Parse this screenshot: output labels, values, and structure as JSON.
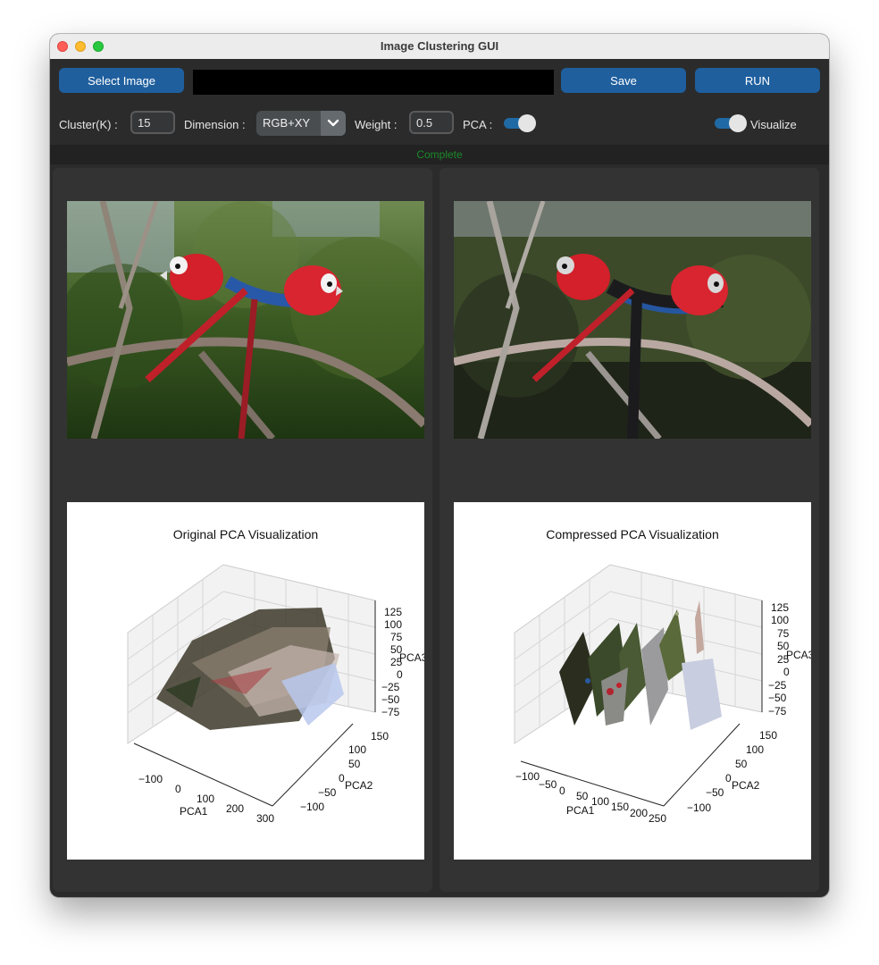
{
  "window": {
    "title": "Image Clustering GUI"
  },
  "toolbar": {
    "select_image_label": "Select Image",
    "path_value": "",
    "save_label": "Save",
    "run_label": "RUN"
  },
  "controls": {
    "cluster_label": "Cluster(K) :",
    "cluster_value": "15",
    "dimension_label": "Dimension :",
    "dimension_value": "RGB+XY",
    "weight_label": "Weight :",
    "weight_value": "0.5",
    "pca_label": "PCA :",
    "pca_on": true,
    "visualize_label": "Visualize",
    "visualize_on": true
  },
  "status": {
    "text": "Complete",
    "color": "#1a8a2a"
  },
  "colors": {
    "accent": "#1f5f9e",
    "window_bg": "#2b2b2b",
    "panel_bg": "#333333"
  },
  "left_panel": {
    "image_icon": "original-parrot-photo",
    "plot": {
      "title": "Original PCA Visualization",
      "x_axis": {
        "label": "PCA1",
        "ticks": [
          "−100",
          "0",
          "100",
          "200",
          "300"
        ]
      },
      "y_axis": {
        "label": "PCA2",
        "ticks": [
          "150",
          "100",
          "50",
          "0",
          "−50",
          "−100"
        ]
      },
      "z_axis": {
        "label": "PCA3",
        "ticks": [
          "125",
          "100",
          "75",
          "50",
          "25",
          "0",
          "−25",
          "−50",
          "−75"
        ]
      }
    }
  },
  "right_panel": {
    "image_icon": "compressed-parrot-photo",
    "plot": {
      "title": "Compressed PCA Visualization",
      "x_axis": {
        "label": "PCA1",
        "ticks": [
          "−100",
          "−50",
          "0",
          "50",
          "100",
          "150",
          "200",
          "250"
        ]
      },
      "y_axis": {
        "label": "PCA2",
        "ticks": [
          "150",
          "100",
          "50",
          "0",
          "−50",
          "−100"
        ]
      },
      "z_axis": {
        "label": "PCA3",
        "ticks": [
          "125",
          "100",
          "75",
          "50",
          "25",
          "0",
          "−25",
          "−50",
          "−75"
        ]
      }
    }
  }
}
